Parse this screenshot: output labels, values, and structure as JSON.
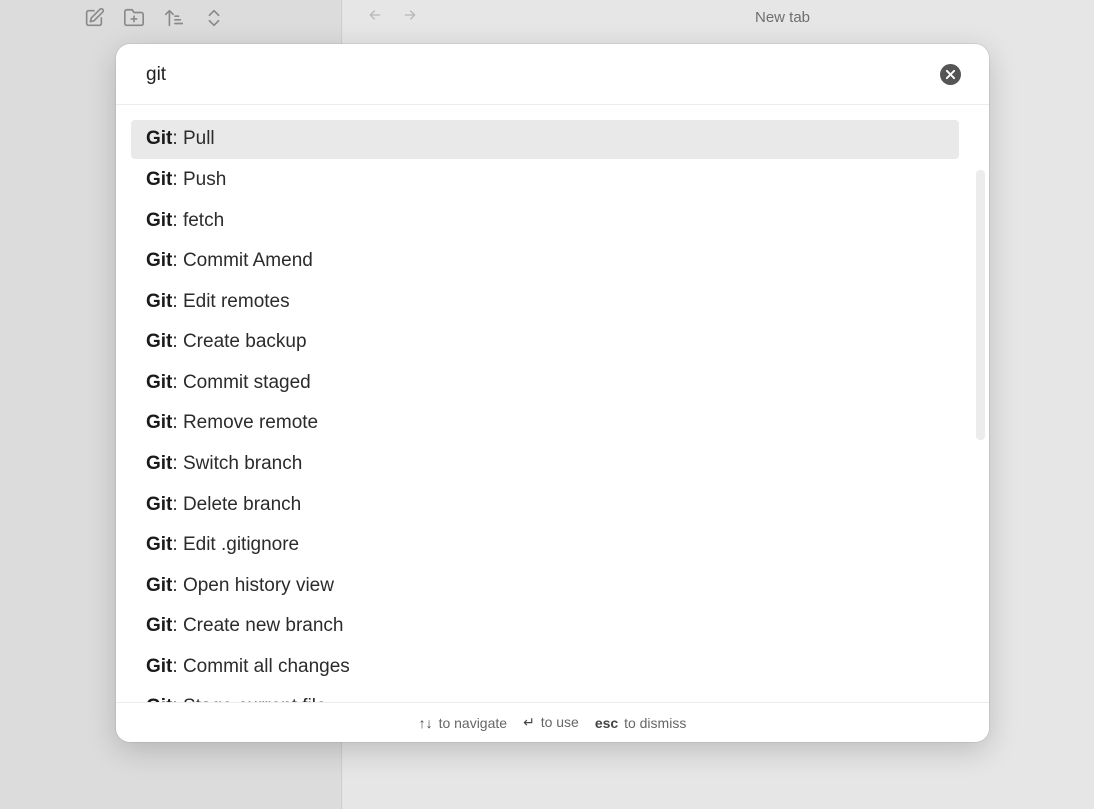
{
  "sidebar": {
    "toolbar": [
      {
        "icon": "new-note-icon"
      },
      {
        "icon": "new-folder-icon"
      },
      {
        "icon": "sort-icon"
      },
      {
        "icon": "collapse-expand-icon"
      }
    ]
  },
  "main": {
    "nav": {
      "back_icon": "arrow-left-icon",
      "forward_icon": "arrow-right-icon"
    },
    "tab_title": "New tab"
  },
  "palette": {
    "search": {
      "value": "git",
      "clear_icon": "close-circle-icon"
    },
    "items": [
      {
        "match": "Git",
        "rest": ": Pull",
        "selected": true
      },
      {
        "match": "Git",
        "rest": ": Push"
      },
      {
        "match": "Git",
        "rest": ": fetch"
      },
      {
        "match": "Git",
        "rest": ": Commit Amend"
      },
      {
        "match": "Git",
        "rest": ": Edit remotes"
      },
      {
        "match": "Git",
        "rest": ": Create backup"
      },
      {
        "match": "Git",
        "rest": ": Commit staged"
      },
      {
        "match": "Git",
        "rest": ": Remove remote"
      },
      {
        "match": "Git",
        "rest": ": Switch branch"
      },
      {
        "match": "Git",
        "rest": ": Delete branch"
      },
      {
        "match": "Git",
        "rest": ": Edit .gitignore"
      },
      {
        "match": "Git",
        "rest": ": Open history view"
      },
      {
        "match": "Git",
        "rest": ": Create new branch"
      },
      {
        "match": "Git",
        "rest": ": Commit all changes"
      },
      {
        "match": "Git",
        "rest": ": Stage current file"
      }
    ],
    "footer": [
      {
        "key": "↑↓",
        "text": "to navigate"
      },
      {
        "key": "↵",
        "text": "to use"
      },
      {
        "key": "esc",
        "text": "to dismiss"
      }
    ]
  },
  "colors": {
    "selected_bg": "#e9e9e9",
    "backdrop": "#e4e4e4",
    "palette_bg": "#ffffff"
  }
}
